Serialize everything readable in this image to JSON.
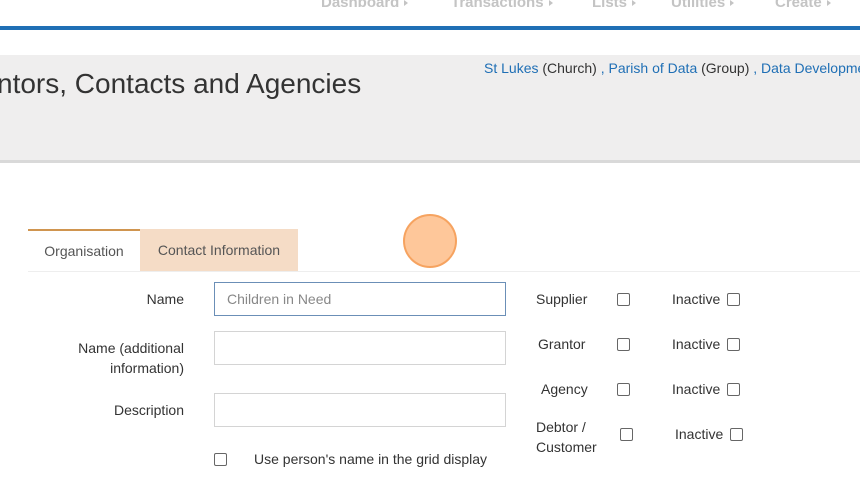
{
  "nav": {
    "items": [
      {
        "label": "Dashboard"
      },
      {
        "label": "Transactions"
      },
      {
        "label": "Lists"
      },
      {
        "label": "Utilities"
      },
      {
        "label": "Create"
      }
    ],
    "accent": "#1f6fb5"
  },
  "header": {
    "title": "ntors, Contacts and Agencies",
    "title_line2": ")",
    "context": {
      "church_name": "St Lukes",
      "church_type": "(Church)",
      "sep1": " , ",
      "group_name": "Parish of Data",
      "group_type": "(Group)",
      "sep2": " , ",
      "more": "Data Development"
    }
  },
  "tabs": {
    "organisation": "Organisation",
    "contact": "Contact Information",
    "active_color": "#f5dcc6"
  },
  "form": {
    "name_label": "Name",
    "name_value": "Children in Need",
    "name_additional_label": "Name (additional information)",
    "name_additional_value": "",
    "description_label": "Description",
    "description_value": "",
    "use_person_name_label": "Use person's name in the grid display"
  },
  "flags": {
    "supplier": "Supplier",
    "grantor": "Grantor",
    "agency": "Agency",
    "debtor": "Debtor / Customer",
    "inactive": "Inactive"
  }
}
